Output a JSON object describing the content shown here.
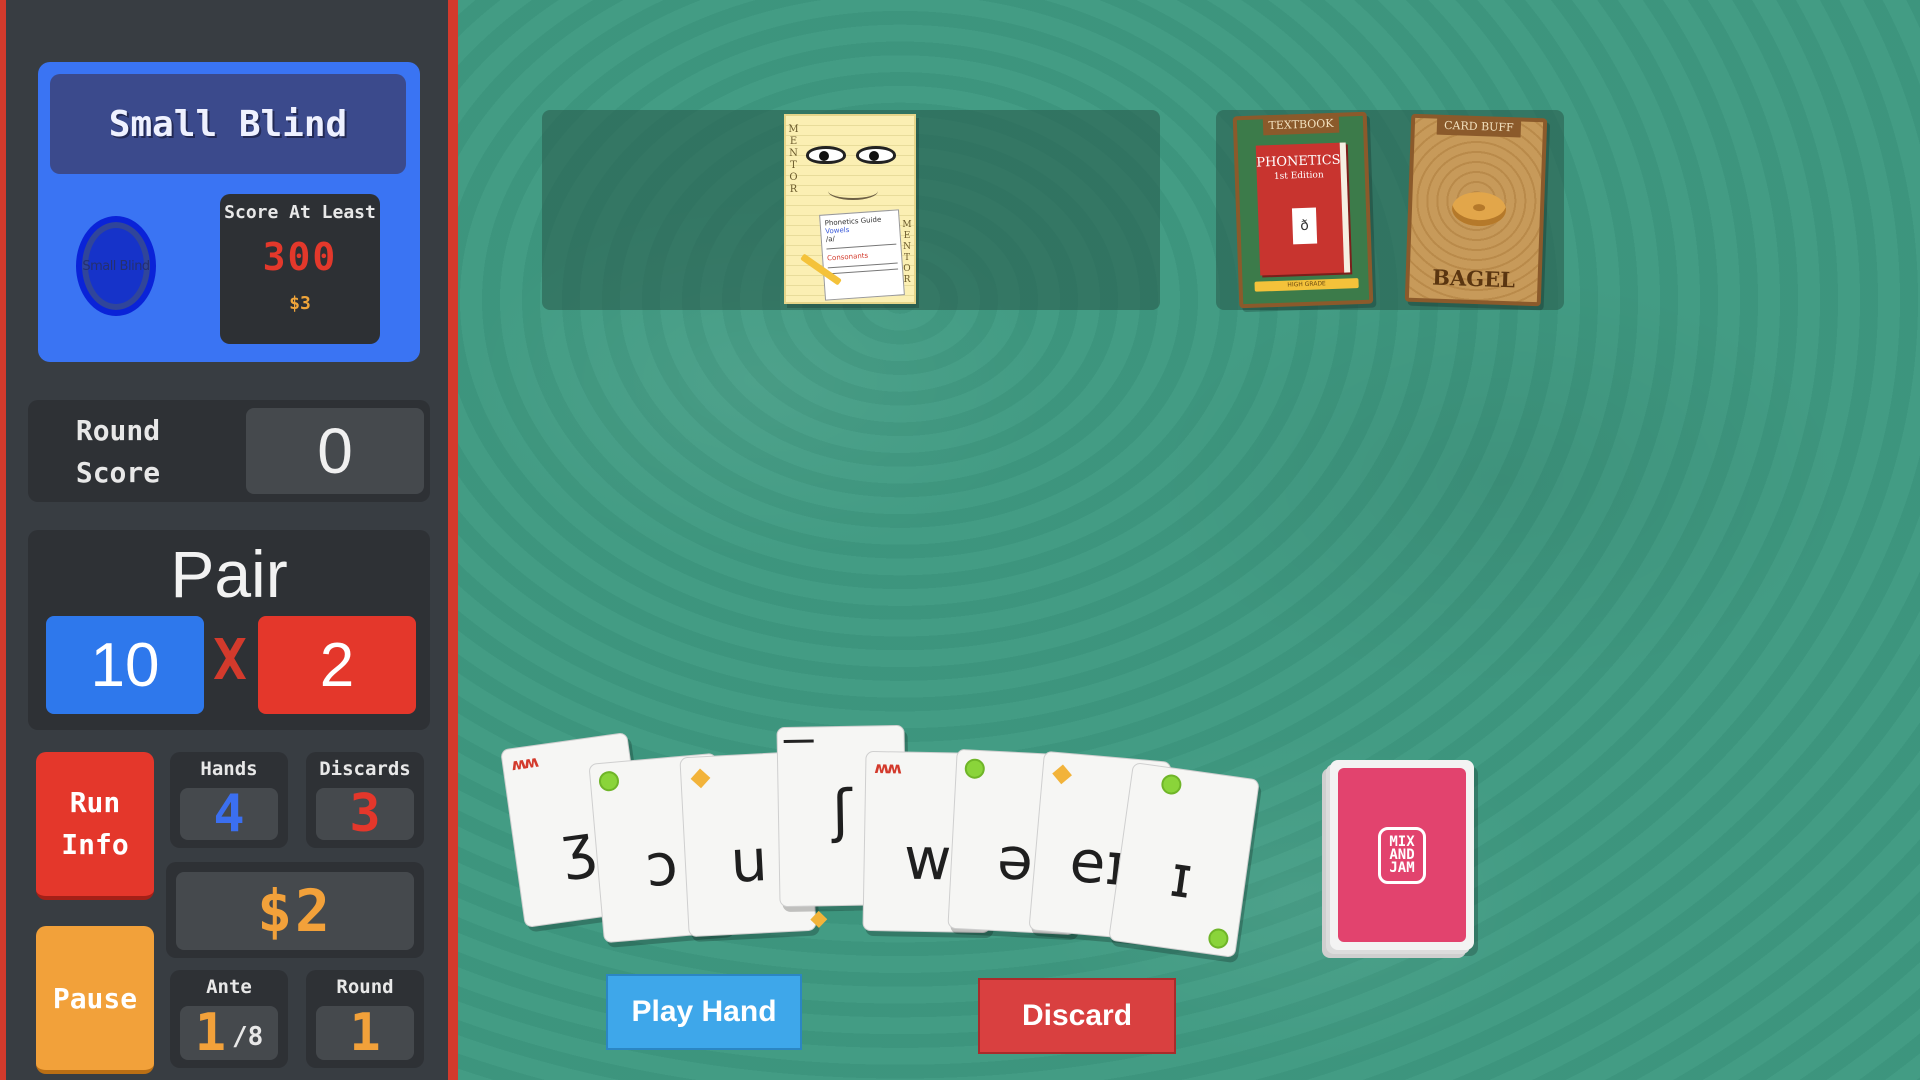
{
  "blind": {
    "name": "Small Blind",
    "chip_label": "Small Blind",
    "score_label": "Score At Least",
    "target": "300",
    "reward": "$3"
  },
  "round_score": {
    "label_line1": "Round",
    "label_line2": "Score",
    "value": "0"
  },
  "hand": {
    "name": "Pair",
    "chips": "10",
    "times": "X",
    "mult": "2"
  },
  "buttons": {
    "run_info_line1": "Run",
    "run_info_line2": "Info",
    "pause": "Pause",
    "play_hand": "Play Hand",
    "discard": "Discard"
  },
  "stats": {
    "hands_label": "Hands",
    "hands_value": "4",
    "discards_label": "Discards",
    "discards_value": "3",
    "money": "$2",
    "ante_label": "Ante",
    "ante_value": "1",
    "ante_of": "/8",
    "round_label": "Round",
    "round_value": "1"
  },
  "jokers": [
    {
      "name": "Mentor",
      "side_left": "MENTOR",
      "side_right": "MENTOR",
      "paper_title": "Phonetics Guide",
      "paper_line1": "Vowels",
      "paper_line2": "/a/",
      "paper_line3": "Consonants"
    }
  ],
  "consumables": [
    {
      "banner": "TEXTBOOK",
      "title": "PHONETICS",
      "subtitle": "1st Edition",
      "glyph": "ð",
      "pencil_text": "HIGH GRADE",
      "icon": "book-icon"
    },
    {
      "banner": "CARD BUFF",
      "name": "BAGEL",
      "icon": "bagel-icon"
    }
  ],
  "cards": [
    {
      "glyph": "ʒ",
      "mark": "wave",
      "mark_text": "ʍʍ"
    },
    {
      "glyph": "ɔ",
      "mark": "dot",
      "mark_text": ""
    },
    {
      "glyph": "u",
      "mark": "diamond",
      "mark_text": ""
    },
    {
      "glyph": "ʃ",
      "mark": "bar",
      "mark_text": ""
    },
    {
      "glyph": "w",
      "mark": "wave",
      "mark_text": "ʍʍ"
    },
    {
      "glyph": "ə",
      "mark": "dot",
      "mark_text": ""
    },
    {
      "glyph": "eɪ",
      "mark": "diamond",
      "mark_text": ""
    },
    {
      "glyph": "ɪ",
      "mark": "dot",
      "mark_text": ""
    }
  ],
  "deck": {
    "logo_line1": "MIX",
    "logo_line2": "AND",
    "logo_line3": "JAM"
  },
  "colors": {
    "table": "#3f9a82",
    "sidebar": "#383d42",
    "sidebar_border": "#d33a2c",
    "blind_panel": "#3a74f3",
    "chips": "#2e78ec",
    "mult": "#e4372b",
    "money": "#f2a13a",
    "play_button": "#3ea7ea",
    "discard_button": "#d94040",
    "deck": "#e2436e"
  }
}
